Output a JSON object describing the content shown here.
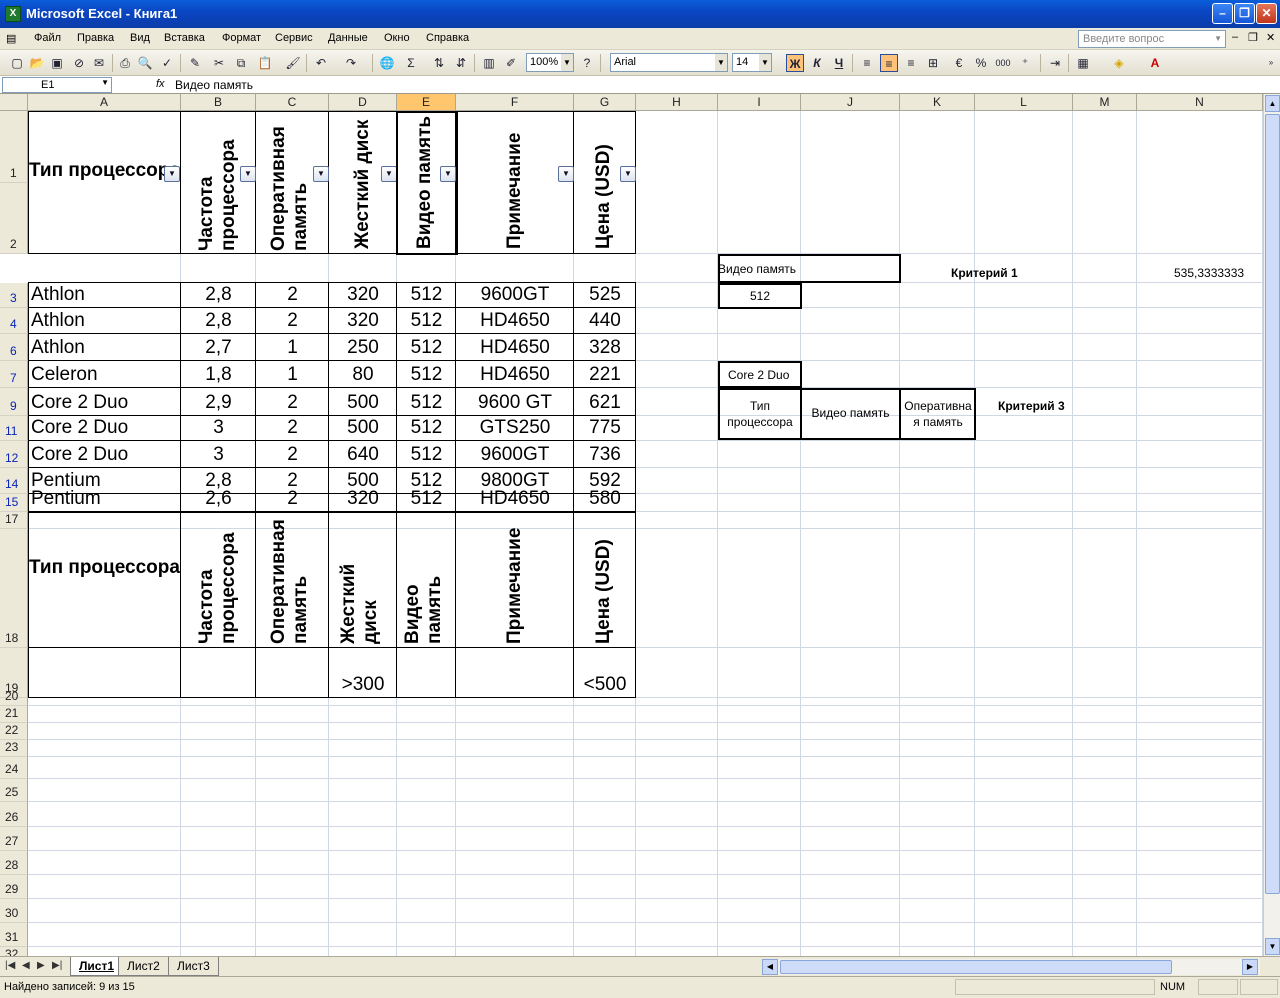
{
  "window": {
    "title": "Microsoft Excel - Книга1",
    "app_icon": "excel-icon"
  },
  "menu": {
    "items": [
      "Файл",
      "Правка",
      "Вид",
      "Вставка",
      "Формат",
      "Сервис",
      "Данные",
      "Окно",
      "Справка"
    ],
    "help_placeholder": "Введите вопрос"
  },
  "toolbar": {
    "zoom": "100%",
    "font": "Arial",
    "font_size": "14",
    "bold": "Ж",
    "italic": "К",
    "underline": "Ч",
    "percent": "%",
    "thousands": "000"
  },
  "formula": {
    "cell_ref": "E1",
    "fx": "fx",
    "value": "Видео память"
  },
  "columns": [
    "A",
    "B",
    "C",
    "D",
    "E",
    "F",
    "G",
    "H",
    "I",
    "J",
    "K",
    "L",
    "M",
    "N"
  ],
  "rows": [
    "1",
    "2",
    "3",
    "4",
    "6",
    "7",
    "9",
    "11",
    "12",
    "14",
    "15",
    "17",
    "18",
    "19",
    "20",
    "21",
    "22",
    "23",
    "24",
    "25",
    "26",
    "27",
    "28",
    "29",
    "30",
    "31",
    "32"
  ],
  "table1": {
    "headers": [
      "Тип процессора",
      "Частота процессора",
      "Оперативная память",
      "Жесткий диск",
      "Видео память",
      "Примечание",
      "Цена (USD)"
    ],
    "rows": [
      [
        "Athlon",
        "2,8",
        "2",
        "320",
        "512",
        "9600GT",
        "525"
      ],
      [
        "Athlon",
        "2,8",
        "2",
        "320",
        "512",
        "HD4650",
        "440"
      ],
      [
        "Athlon",
        "2,7",
        "1",
        "250",
        "512",
        "HD4650",
        "328"
      ],
      [
        "Celeron",
        "1,8",
        "1",
        "80",
        "512",
        "HD4650",
        "221"
      ],
      [
        "Core 2 Duo",
        "2,9",
        "2",
        "500",
        "512",
        "9600 GT",
        "621"
      ],
      [
        "Core 2 Duo",
        "3",
        "2",
        "500",
        "512",
        "GTS250",
        "775"
      ],
      [
        "Core 2 Duo",
        "3",
        "2",
        "640",
        "512",
        "9600GT",
        "736"
      ],
      [
        "Pentium",
        "2,8",
        "2",
        "500",
        "512",
        "9800GT",
        "592"
      ],
      [
        "Pentium",
        "2,6",
        "2",
        "320",
        "512",
        "HD4650",
        "580"
      ]
    ]
  },
  "table2": {
    "headers": [
      "Тип процессора",
      "Частота процессора",
      "Оперативная память",
      "Жесткий диск",
      "Видео память",
      "Примечание",
      "Цена (USD)"
    ],
    "criteria": [
      "",
      "",
      "",
      ">300",
      "",
      "",
      "<500"
    ]
  },
  "side": {
    "crit1_header": "Видео память",
    "crit1_value": "512",
    "crit1_label": "Критерий 1",
    "avg_value": "535,3333333",
    "crit3_value": "Core 2 Duo",
    "crit3_h1": "Тип процессора",
    "crit3_h2": "Видео память",
    "crit3_h3": "Оперативная память",
    "crit3_label": "Критерий 3"
  },
  "sheets": [
    "Лист1",
    "Лист2",
    "Лист3"
  ],
  "status": {
    "text": "Найдено записей: 9 из 15",
    "num": "NUM"
  }
}
